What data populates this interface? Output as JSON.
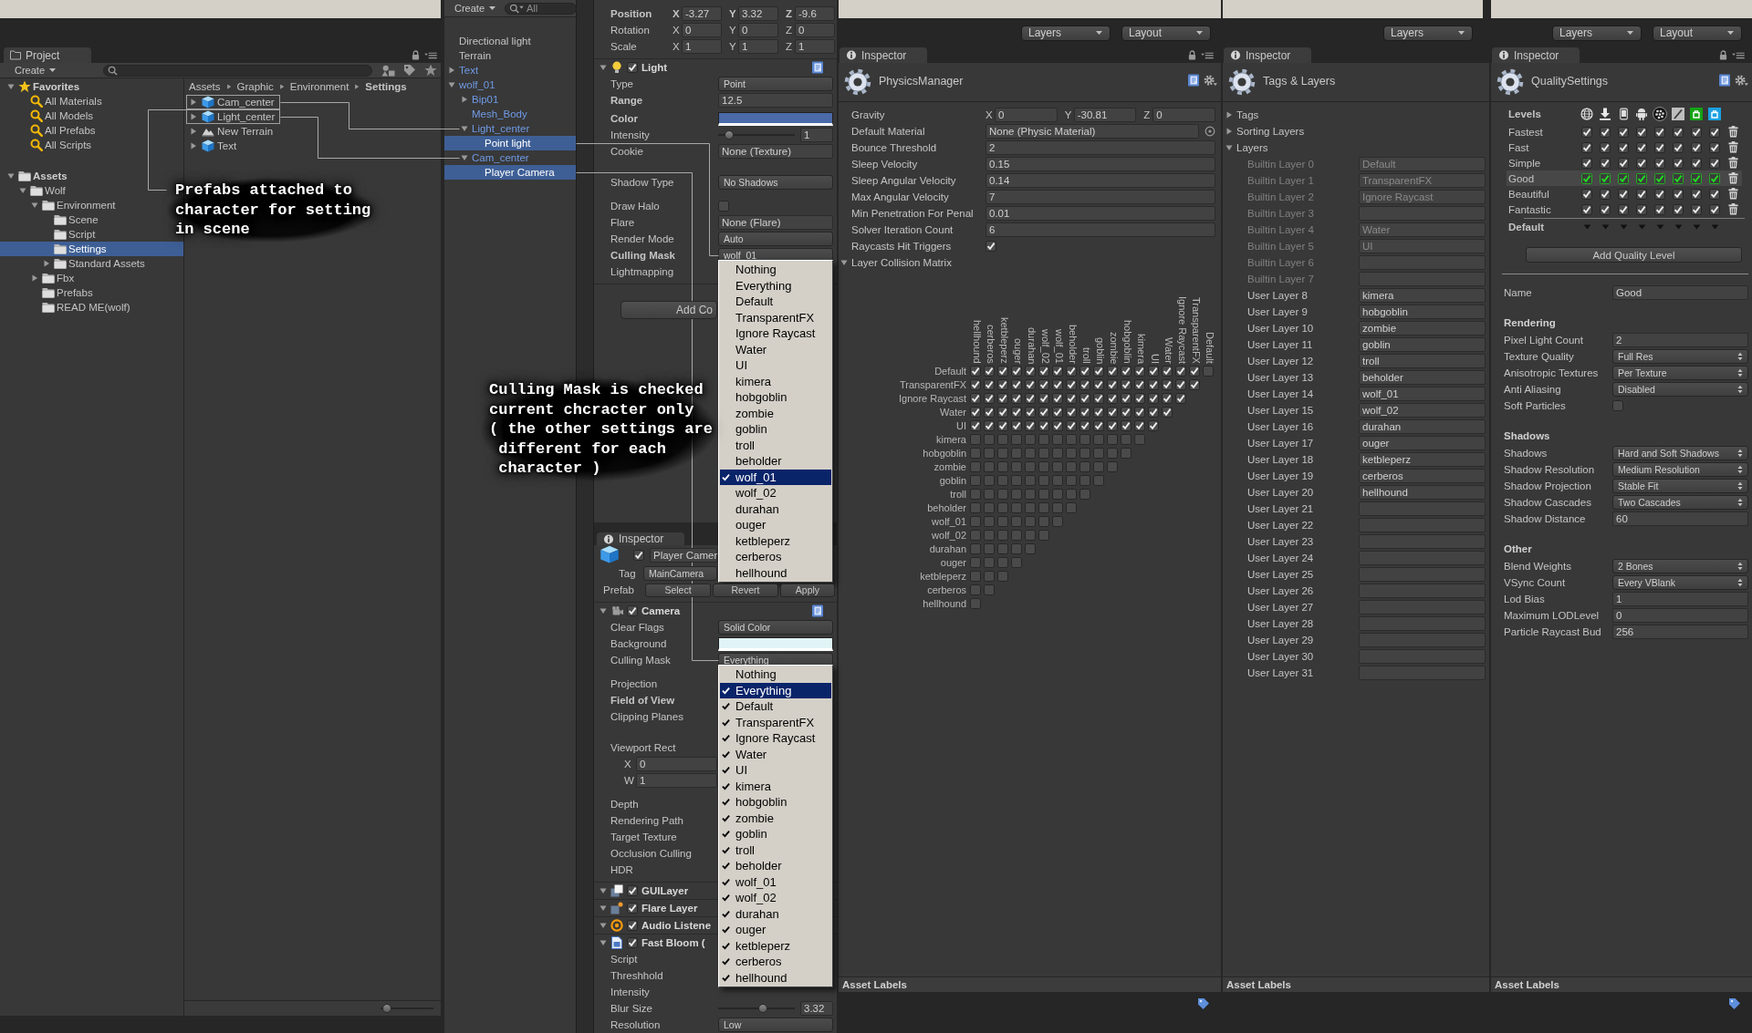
{
  "project": {
    "tab": "Project",
    "create": "Create",
    "tree": [
      {
        "label": "Favorites",
        "kind": "favorites",
        "expanded": true,
        "selected": false,
        "children": [
          {
            "label": "All Materials",
            "kind": "search",
            "selected": false
          },
          {
            "label": "All Models",
            "kind": "search",
            "selected": false
          },
          {
            "label": "All Prefabs",
            "kind": "search",
            "selected": false
          },
          {
            "label": "All Scripts",
            "kind": "search",
            "selected": false
          }
        ]
      },
      {
        "label": "Assets",
        "kind": "folder",
        "expanded": true,
        "selected": false,
        "children": [
          {
            "label": "Wolf",
            "kind": "folder",
            "expanded": true,
            "selected": false,
            "children": [
              {
                "label": "Environment",
                "kind": "folder",
                "expanded": true,
                "selected": false,
                "children": [
                  {
                    "label": "Scene",
                    "kind": "folder",
                    "selected": false
                  },
                  {
                    "label": "Script",
                    "kind": "folder",
                    "selected": false
                  },
                  {
                    "label": "Settings",
                    "kind": "folder",
                    "selected": true
                  },
                  {
                    "label": "Standard Assets",
                    "kind": "folder",
                    "expanded": false,
                    "selected": false
                  }
                ]
              },
              {
                "label": "Fbx",
                "kind": "folder",
                "expanded": false,
                "selected": false
              },
              {
                "label": "Prefabs",
                "kind": "folder",
                "selected": false
              },
              {
                "label": "READ ME(wolf)",
                "kind": "folder",
                "selected": false
              }
            ]
          }
        ]
      }
    ],
    "breadcrumb": [
      "Assets",
      "Graphic",
      "Environment",
      "Settings"
    ],
    "files": [
      {
        "name": "Cam_center",
        "kind": "prefab",
        "expanded": false,
        "selected": false,
        "highlighted": true
      },
      {
        "name": "Light_center",
        "kind": "prefab",
        "expanded": false,
        "selected": false,
        "highlighted": true
      },
      {
        "name": "New Terrain",
        "kind": "terrain",
        "expanded": false,
        "selected": false,
        "highlighted": false
      },
      {
        "name": "Text",
        "kind": "prefab",
        "expanded": false,
        "selected": false,
        "highlighted": false
      }
    ],
    "icon_size": {
      "level": 0.05
    }
  },
  "hierarchy": {
    "create": "Create",
    "search": {
      "placeholder": "All"
    },
    "items": [
      {
        "label": "Directional light",
        "prefab": false,
        "selected": false
      },
      {
        "label": "Terrain",
        "prefab": false,
        "selected": false
      },
      {
        "label": "Text",
        "prefab": true,
        "expanded": false,
        "selected": false
      },
      {
        "label": "wolf_01",
        "prefab": true,
        "expanded": true,
        "selected": false,
        "children": [
          {
            "label": "Bip01",
            "prefab": true,
            "expanded": false,
            "selected": false
          },
          {
            "label": "Mesh_Body",
            "prefab": true,
            "selected": false
          },
          {
            "label": "Light_center",
            "prefab": true,
            "expanded": true,
            "selected": false,
            "children": [
              {
                "label": "Point light",
                "selected": true
              }
            ]
          },
          {
            "label": "Cam_center",
            "prefab": true,
            "expanded": true,
            "selected": false,
            "children": [
              {
                "label": "Player Camera",
                "selected": true
              }
            ]
          }
        ]
      }
    ]
  },
  "inspector_light": {
    "transform": [
      {
        "label": "Position",
        "overridden": true,
        "axes": [
          {
            "axis": "X",
            "value": "-3.27"
          },
          {
            "axis": "Y",
            "value": "3.32"
          },
          {
            "axis": "Z",
            "value": "-9.6"
          }
        ]
      },
      {
        "label": "Rotation",
        "overridden": false,
        "axes": [
          {
            "axis": "X",
            "value": "0"
          },
          {
            "axis": "Y",
            "value": "0"
          },
          {
            "axis": "Z",
            "value": "0"
          }
        ]
      },
      {
        "label": "Scale",
        "overridden": false,
        "axes": [
          {
            "axis": "X",
            "value": "1"
          },
          {
            "axis": "Y",
            "value": "1"
          },
          {
            "axis": "Z",
            "value": "1"
          }
        ]
      }
    ],
    "component": {
      "title": "Light",
      "kind": "light",
      "enabled": true,
      "expanded": true,
      "properties": [
        {
          "label": "Type",
          "overridden": false,
          "kind": "dropdown",
          "value": "Point"
        },
        {
          "label": "Range",
          "overridden": true,
          "kind": "field",
          "value": "12.5"
        },
        {
          "label": "Color",
          "overridden": true,
          "kind": "color",
          "color": "#4a6aa8"
        },
        {
          "label": "Intensity",
          "overridden": false,
          "kind": "slider",
          "level": 0.1,
          "value": "1"
        },
        {
          "label": "Cookie",
          "overridden": false,
          "kind": "object",
          "value": "None (Texture)"
        },
        {
          "label": "Shadow Type",
          "overridden": false,
          "kind": "dropdown",
          "value": "No Shadows"
        },
        {
          "label": "Draw Halo",
          "overridden": false,
          "kind": "checkbox",
          "checked": false
        },
        {
          "label": "Flare",
          "overridden": false,
          "kind": "object",
          "value": "None (Flare)"
        },
        {
          "label": "Render Mode",
          "overridden": false,
          "kind": "dropdown",
          "value": "Auto"
        },
        {
          "label": "Culling Mask",
          "overridden": true,
          "kind": "dropdown",
          "value": "wolf_01",
          "menu": {
            "items": [
              {
                "label": "Nothing",
                "checked": false,
                "selected": false
              },
              {
                "label": "Everything",
                "checked": false,
                "selected": false
              },
              {
                "label": "Default",
                "checked": false,
                "selected": false
              },
              {
                "label": "TransparentFX",
                "checked": false,
                "selected": false
              },
              {
                "label": "Ignore Raycast",
                "checked": false,
                "selected": false
              },
              {
                "label": "Water",
                "checked": false,
                "selected": false
              },
              {
                "label": "UI",
                "checked": false,
                "selected": false
              },
              {
                "label": "kimera",
                "checked": false,
                "selected": false
              },
              {
                "label": "hobgoblin",
                "checked": false,
                "selected": false
              },
              {
                "label": "zombie",
                "checked": false,
                "selected": false
              },
              {
                "label": "goblin",
                "checked": false,
                "selected": false
              },
              {
                "label": "troll",
                "checked": false,
                "selected": false
              },
              {
                "label": "beholder",
                "checked": false,
                "selected": false
              },
              {
                "label": "wolf_01",
                "checked": true,
                "selected": true
              },
              {
                "label": "wolf_02",
                "checked": false,
                "selected": false
              },
              {
                "label": "durahan",
                "checked": false,
                "selected": false
              },
              {
                "label": "ouger",
                "checked": false,
                "selected": false
              },
              {
                "label": "ketbleperz",
                "checked": false,
                "selected": false
              },
              {
                "label": "cerberos",
                "checked": false,
                "selected": false
              },
              {
                "label": "hellhound",
                "checked": false,
                "selected": false
              }
            ]
          }
        },
        {
          "label": "Lightmapping",
          "overridden": false,
          "kind": "label"
        }
      ]
    },
    "add_button": "Add Co"
  },
  "inspector_camera": {
    "tab": "Inspector",
    "object": {
      "name": "Player Camer",
      "active": true,
      "tag_label": "Tag",
      "tag": "MainCamera",
      "prefab_label": "Prefab",
      "buttons": [
        "Select",
        "Revert",
        "Apply"
      ]
    },
    "components": [
      {
        "title": "Camera",
        "kind": "camera",
        "enabled": true,
        "expanded": true,
        "properties": [
          {
            "label": "Clear Flags",
            "overridden": false,
            "kind": "dropdown",
            "value": "Solid Color"
          },
          {
            "label": "Background",
            "overridden": false,
            "kind": "color",
            "color": "#e0f4f6"
          },
          {
            "label": "Culling Mask",
            "overridden": false,
            "kind": "dropdown",
            "value": "Everything",
            "menu": {
              "items": [
                {
                  "label": "Nothing",
                  "checked": false,
                  "selected": false
                },
                {
                  "label": "Everything",
                  "checked": true,
                  "selected": true
                },
                {
                  "label": "Default",
                  "checked": true,
                  "selected": false
                },
                {
                  "label": "TransparentFX",
                  "checked": true,
                  "selected": false
                },
                {
                  "label": "Ignore Raycast",
                  "checked": true,
                  "selected": false
                },
                {
                  "label": "Water",
                  "checked": true,
                  "selected": false
                },
                {
                  "label": "UI",
                  "checked": true,
                  "selected": false
                },
                {
                  "label": "kimera",
                  "checked": true,
                  "selected": false
                },
                {
                  "label": "hobgoblin",
                  "checked": true,
                  "selected": false
                },
                {
                  "label": "zombie",
                  "checked": true,
                  "selected": false
                },
                {
                  "label": "goblin",
                  "checked": true,
                  "selected": false
                },
                {
                  "label": "troll",
                  "checked": true,
                  "selected": false
                },
                {
                  "label": "beholder",
                  "checked": true,
                  "selected": false
                },
                {
                  "label": "wolf_01",
                  "checked": true,
                  "selected": false
                },
                {
                  "label": "wolf_02",
                  "checked": true,
                  "selected": false
                },
                {
                  "label": "durahan",
                  "checked": true,
                  "selected": false
                },
                {
                  "label": "ouger",
                  "checked": true,
                  "selected": false
                },
                {
                  "label": "ketbleperz",
                  "checked": true,
                  "selected": false
                },
                {
                  "label": "cerberos",
                  "checked": true,
                  "selected": false
                },
                {
                  "label": "hellhound",
                  "checked": true,
                  "selected": false
                }
              ]
            }
          },
          {
            "label": "Projection",
            "overridden": false,
            "kind": "label"
          },
          {
            "label": "Field of View",
            "overridden": true,
            "kind": "label"
          },
          {
            "label": "Clipping Planes",
            "overridden": false,
            "kind": "label"
          },
          {
            "label": "Viewport Rect",
            "overridden": false,
            "kind": "rect",
            "fields": [
              {
                "axis": "X",
                "value": "0"
              },
              {
                "axis": "W",
                "value": "1"
              }
            ]
          },
          {
            "label": "Depth",
            "overridden": false,
            "kind": "label"
          },
          {
            "label": "Rendering Path",
            "overridden": false,
            "kind": "label"
          },
          {
            "label": "Target Texture",
            "overridden": false,
            "kind": "label"
          },
          {
            "label": "Occlusion Culling",
            "overridden": false,
            "kind": "label"
          },
          {
            "label": "HDR",
            "overridden": false,
            "kind": "label"
          }
        ]
      },
      {
        "title": "GUILayer",
        "kind": "gui_layer",
        "enabled": true,
        "expanded": true
      },
      {
        "title": "Flare Layer",
        "kind": "flare",
        "enabled": true,
        "expanded": true
      },
      {
        "title": "Audio Listene",
        "kind": "audio",
        "enabled": true,
        "expanded": true
      },
      {
        "title": "Fast Bloom (",
        "kind": "script",
        "enabled": true,
        "expanded": true,
        "properties": [
          {
            "label": "Script",
            "overridden": false,
            "kind": "label"
          },
          {
            "label": "Threshhold",
            "overridden": false,
            "kind": "label"
          },
          {
            "label": "Intensity",
            "overridden": false,
            "kind": "label"
          },
          {
            "label": "Blur Size",
            "overridden": false,
            "kind": "slider",
            "level": 0.59,
            "value": "3.32"
          },
          {
            "label": "Resolution",
            "overridden": false,
            "kind": "dropdown",
            "value": "Low"
          }
        ]
      }
    ]
  },
  "physics": {
    "toolbar": [
      "Layers",
      "Layout"
    ],
    "tab": "Inspector",
    "title": "PhysicsManager",
    "properties": [
      {
        "label": "Gravity",
        "kind": "vector",
        "axes": [
          {
            "axis": "X",
            "value": "0"
          },
          {
            "axis": "Y",
            "value": "-30.81"
          },
          {
            "axis": "Z",
            "value": "0"
          }
        ]
      },
      {
        "label": "Default Material",
        "kind": "object",
        "value": "None (Physic Material)"
      },
      {
        "label": "Bounce Threshold",
        "kind": "field",
        "value": "2"
      },
      {
        "label": "Sleep Velocity",
        "kind": "field",
        "value": "0.15"
      },
      {
        "label": "Sleep Angular Velocity",
        "kind": "field",
        "value": "0.14"
      },
      {
        "label": "Max Angular Velocity",
        "kind": "field",
        "value": "7"
      },
      {
        "label": "Min Penetration For Penal",
        "kind": "field",
        "value": "0.01"
      },
      {
        "label": "Solver Iteration Count",
        "kind": "field",
        "value": "6"
      },
      {
        "label": "Raycasts Hit Triggers",
        "kind": "checkbox",
        "checked": true
      }
    ],
    "matrix": {
      "label": "Layer Collision Matrix",
      "expanded": true,
      "columns": [
        "hellhound",
        "cerberos",
        "ketbleperz",
        "ouger",
        "durahan",
        "wolf_02",
        "wolf_01",
        "beholder",
        "troll",
        "goblin",
        "zombie",
        "hobgoblin",
        "kimera",
        "UI",
        "Water",
        "Ignore Raycast",
        "TransparentFX",
        "Default"
      ],
      "rows": [
        {
          "label": "Default",
          "cells": [
            true,
            true,
            true,
            true,
            true,
            true,
            true,
            true,
            true,
            true,
            true,
            true,
            true,
            true,
            true,
            true,
            true,
            false
          ]
        },
        {
          "label": "TransparentFX",
          "cells": [
            true,
            true,
            true,
            true,
            true,
            true,
            true,
            true,
            true,
            true,
            true,
            true,
            true,
            true,
            true,
            true,
            true
          ]
        },
        {
          "label": "Ignore Raycast",
          "cells": [
            true,
            true,
            true,
            true,
            true,
            true,
            true,
            true,
            true,
            true,
            true,
            true,
            true,
            true,
            true,
            true
          ]
        },
        {
          "label": "Water",
          "cells": [
            true,
            true,
            true,
            true,
            true,
            true,
            true,
            true,
            true,
            true,
            true,
            true,
            true,
            true,
            true
          ]
        },
        {
          "label": "UI",
          "cells": [
            true,
            true,
            true,
            true,
            true,
            true,
            true,
            true,
            true,
            true,
            true,
            true,
            true,
            true
          ]
        },
        {
          "label": "kimera",
          "cells": [
            false,
            false,
            false,
            false,
            false,
            false,
            false,
            false,
            false,
            false,
            false,
            false,
            false
          ]
        },
        {
          "label": "hobgoblin",
          "cells": [
            false,
            false,
            false,
            false,
            false,
            false,
            false,
            false,
            false,
            false,
            false,
            false
          ]
        },
        {
          "label": "zombie",
          "cells": [
            false,
            false,
            false,
            false,
            false,
            false,
            false,
            false,
            false,
            false,
            false
          ]
        },
        {
          "label": "goblin",
          "cells": [
            false,
            false,
            false,
            false,
            false,
            false,
            false,
            false,
            false,
            false
          ]
        },
        {
          "label": "troll",
          "cells": [
            false,
            false,
            false,
            false,
            false,
            false,
            false,
            false,
            false
          ]
        },
        {
          "label": "beholder",
          "cells": [
            false,
            false,
            false,
            false,
            false,
            false,
            false,
            false
          ]
        },
        {
          "label": "wolf_01",
          "cells": [
            false,
            false,
            false,
            false,
            false,
            false,
            false
          ]
        },
        {
          "label": "wolf_02",
          "cells": [
            false,
            false,
            false,
            false,
            false,
            false
          ]
        },
        {
          "label": "durahan",
          "cells": [
            false,
            false,
            false,
            false,
            false
          ]
        },
        {
          "label": "ouger",
          "cells": [
            false,
            false,
            false,
            false
          ]
        },
        {
          "label": "ketbleperz",
          "cells": [
            false,
            false,
            false
          ]
        },
        {
          "label": "cerberos",
          "cells": [
            false,
            false
          ]
        },
        {
          "label": "hellhound",
          "cells": [
            false
          ]
        }
      ]
    },
    "footer": "Asset Labels"
  },
  "tags_layers": {
    "toolbar": [
      "Layers"
    ],
    "tab": "Inspector",
    "title": "Tags & Layers",
    "sections": [
      {
        "label": "Tags",
        "expanded": false
      },
      {
        "label": "Sorting Layers",
        "expanded": false
      },
      {
        "label": "Layers",
        "expanded": true,
        "layers": [
          {
            "label": "Builtin Layer 0",
            "value": "Default",
            "disabled": true
          },
          {
            "label": "Builtin Layer 1",
            "value": "TransparentFX",
            "disabled": true
          },
          {
            "label": "Builtin Layer 2",
            "value": "Ignore Raycast",
            "disabled": true
          },
          {
            "label": "Builtin Layer 3",
            "disabled": true
          },
          {
            "label": "Builtin Layer 4",
            "value": "Water",
            "disabled": true
          },
          {
            "label": "Builtin Layer 5",
            "value": "UI",
            "disabled": true
          },
          {
            "label": "Builtin Layer 6",
            "disabled": true
          },
          {
            "label": "Builtin Layer 7",
            "disabled": true
          },
          {
            "label": "User Layer 8",
            "value": "kimera",
            "disabled": false
          },
          {
            "label": "User Layer 9",
            "value": "hobgoblin",
            "disabled": false
          },
          {
            "label": "User Layer 10",
            "value": "zombie",
            "disabled": false
          },
          {
            "label": "User Layer 11",
            "value": "goblin",
            "disabled": false
          },
          {
            "label": "User Layer 12",
            "value": "troll",
            "disabled": false
          },
          {
            "label": "User Layer 13",
            "value": "beholder",
            "disabled": false
          },
          {
            "label": "User Layer 14",
            "value": "wolf_01",
            "disabled": false
          },
          {
            "label": "User Layer 15",
            "value": "wolf_02",
            "disabled": false
          },
          {
            "label": "User Layer 16",
            "value": "durahan",
            "disabled": false
          },
          {
            "label": "User Layer 17",
            "value": "ouger",
            "disabled": false
          },
          {
            "label": "User Layer 18",
            "value": "ketbleperz",
            "disabled": false
          },
          {
            "label": "User Layer 19",
            "value": "cerberos",
            "disabled": false
          },
          {
            "label": "User Layer 20",
            "value": "hellhound",
            "disabled": false
          },
          {
            "label": "User Layer 21",
            "disabled": false
          },
          {
            "label": "User Layer 22",
            "disabled": false
          },
          {
            "label": "User Layer 23",
            "disabled": false
          },
          {
            "label": "User Layer 24",
            "disabled": false
          },
          {
            "label": "User Layer 25",
            "disabled": false
          },
          {
            "label": "User Layer 26",
            "disabled": false
          },
          {
            "label": "User Layer 27",
            "disabled": false
          },
          {
            "label": "User Layer 28",
            "disabled": false
          },
          {
            "label": "User Layer 29",
            "disabled": false
          },
          {
            "label": "User Layer 30",
            "disabled": false
          },
          {
            "label": "User Layer 31",
            "disabled": false
          }
        ]
      }
    ],
    "footer": "Asset Labels"
  },
  "quality": {
    "toolbar": [
      "Layers",
      "Layout"
    ],
    "tab": "Inspector",
    "title": "QualitySettings",
    "levels_label": "Levels",
    "levels": [
      {
        "name": "Fastest",
        "selected": false,
        "platforms": [
          true,
          true,
          true,
          true,
          true,
          true,
          true,
          true
        ]
      },
      {
        "name": "Fast",
        "selected": false,
        "platforms": [
          true,
          true,
          true,
          true,
          true,
          true,
          true,
          true
        ]
      },
      {
        "name": "Simple",
        "selected": false,
        "platforms": [
          true,
          true,
          true,
          true,
          true,
          true,
          true,
          true
        ]
      },
      {
        "name": "Good",
        "selected": true,
        "platforms": [
          true,
          true,
          true,
          true,
          true,
          true,
          true,
          true
        ]
      },
      {
        "name": "Beautiful",
        "selected": false,
        "platforms": [
          true,
          true,
          true,
          true,
          true,
          true,
          true,
          true
        ]
      },
      {
        "name": "Fantastic",
        "selected": false,
        "platforms": [
          true,
          true,
          true,
          true,
          true,
          true,
          true,
          true
        ]
      }
    ],
    "default_label": "Default",
    "add_button": "Add Quality Level",
    "name": {
      "label": "Name",
      "kind": "field",
      "value": "Good"
    },
    "groups": [
      {
        "title": "Rendering",
        "properties": [
          {
            "label": "Pixel Light Count",
            "kind": "field",
            "value": "2"
          },
          {
            "label": "Texture Quality",
            "kind": "dropdown",
            "value": "Full Res"
          },
          {
            "label": "Anisotropic Textures",
            "kind": "dropdown",
            "value": "Per Texture"
          },
          {
            "label": "Anti Aliasing",
            "kind": "dropdown",
            "value": "Disabled"
          },
          {
            "label": "Soft Particles",
            "kind": "checkbox",
            "checked": false
          }
        ]
      },
      {
        "title": "Shadows",
        "properties": [
          {
            "label": "Shadows",
            "kind": "dropdown",
            "value": "Hard and Soft Shadows"
          },
          {
            "label": "Shadow Resolution",
            "kind": "dropdown",
            "value": "Medium Resolution"
          },
          {
            "label": "Shadow Projection",
            "kind": "dropdown",
            "value": "Stable Fit"
          },
          {
            "label": "Shadow Cascades",
            "kind": "dropdown",
            "value": "Two Cascades"
          },
          {
            "label": "Shadow Distance",
            "kind": "field",
            "value": "60"
          }
        ]
      },
      {
        "title": "Other",
        "properties": [
          {
            "label": "Blend Weights",
            "kind": "dropdown",
            "value": "2 Bones"
          },
          {
            "label": "VSync Count",
            "kind": "dropdown",
            "value": "Every VBlank"
          },
          {
            "label": "Lod Bias",
            "kind": "field",
            "value": "1"
          },
          {
            "label": "Maximum LODLevel",
            "kind": "field",
            "value": "0"
          },
          {
            "label": "Particle Raycast Bud",
            "kind": "field",
            "value": "256"
          }
        ]
      }
    ],
    "footer": "Asset Labels"
  },
  "annotations": [
    {
      "text": "Prefabs attached to\ncharacter for setting\nin scene"
    },
    {
      "text": "Culling Mask is checked\ncurrent chcracter only\n( the other settings are\n different for each\n character )"
    }
  ]
}
